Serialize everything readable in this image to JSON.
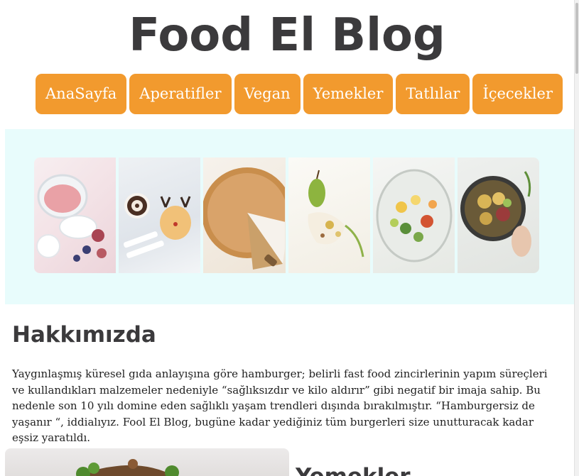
{
  "header": {
    "title": "Food El Blog"
  },
  "nav": {
    "items": [
      {
        "label": "AnaSayfa"
      },
      {
        "label": "Aperatifler"
      },
      {
        "label": "Vegan"
      },
      {
        "label": "Yemekler"
      },
      {
        "label": "Tatlılar"
      },
      {
        "label": "İçecekler"
      }
    ]
  },
  "hero": {
    "images": [
      {
        "icon": "chia-pudding-jar-image"
      },
      {
        "icon": "swiss-roll-reindeer-dessert-image"
      },
      {
        "icon": "pumpkin-pie-image"
      },
      {
        "icon": "pear-plated-dish-image"
      },
      {
        "icon": "salad-glass-image"
      },
      {
        "icon": "potato-bowl-image"
      }
    ]
  },
  "about": {
    "heading": "Hakkımızda",
    "text": "Yaygınlaşmış küresel gıda anlayışına göre hamburger; belirli fast food zincirlerinin yapım süreçleri ve kullandıkları malzemeler nedeniyle “sağlıksızdır ve kilo aldırır” gibi negatif bir imaja sahip. Bu nedenle son 10 yılı domine eden sağlıklı yaşam trendleri dışında bırakılmıştır. “Hamburgersiz de yaşanır “, iddialıyız. Fool El Blog, bugüne kadar yediğiniz tüm burgerleri size unutturacak kadar eşsiz yaratıldı."
  },
  "next_section": {
    "heading": "Yemekler"
  },
  "colors": {
    "accent": "#f29a2e",
    "hero_bg": "#e8fcfc",
    "title": "#3b3a3c"
  }
}
